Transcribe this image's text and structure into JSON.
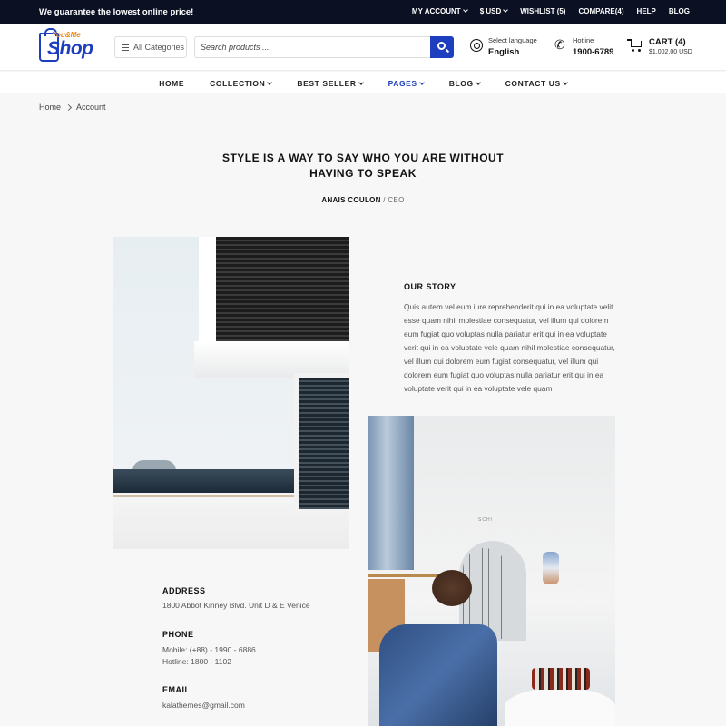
{
  "topbar": {
    "promo": "We guarantee the lowest online price!",
    "links": [
      {
        "label": "MY ACCOUNT",
        "dropdown": true
      },
      {
        "label": "$ USD",
        "dropdown": true
      },
      {
        "label": "WISHLIST (5)",
        "dropdown": false
      },
      {
        "label": "COMPARE(4)",
        "dropdown": false
      },
      {
        "label": "HELP",
        "dropdown": false
      },
      {
        "label": "BLOG",
        "dropdown": false
      }
    ]
  },
  "logo": {
    "small": "You&Me",
    "big": "Shop"
  },
  "header": {
    "categories_label": "All Categories",
    "search_placeholder": "Search products ...",
    "language_label": "Select language",
    "language_value": "English",
    "hotline_label": "Hotline",
    "hotline_value": "1900-6789",
    "cart_label": "CART (4)",
    "cart_total": "$1,002.00 USD"
  },
  "nav": {
    "items": [
      {
        "label": "HOME",
        "dropdown": false,
        "active": false
      },
      {
        "label": "COLLECTION",
        "dropdown": true,
        "active": false
      },
      {
        "label": "BEST SELLER",
        "dropdown": true,
        "active": false
      },
      {
        "label": "PAGES",
        "dropdown": true,
        "active": true
      },
      {
        "label": "BLOG",
        "dropdown": true,
        "active": false
      },
      {
        "label": "CONTACT US",
        "dropdown": true,
        "active": false
      }
    ]
  },
  "breadcrumb": {
    "home": "Home",
    "current": "Account"
  },
  "quote": {
    "text": "STYLE IS A WAY TO SAY WHO YOU ARE WITHOUT HAVING TO SPEAK",
    "author": "ANAIS COULON",
    "separator": "/",
    "role": "CEO"
  },
  "story": {
    "title": "OUR STORY",
    "text": "Quis autem vel eum iure reprehenderit qui in ea voluptate velit esse quam nihil molestiae consequatur, vel illum qui dolorem eum fugiat quo voluptas nulla pariatur erit qui in ea voluptate verit qui in ea voluptate vele quam nihil molestiae consequatur, vel illum qui dolorem eum fugiat consequatur, vel illum qui dolorem eum fugiat quo voluptas nulla pariatur erit qui in ea voluptate verit qui in ea voluptate vele quam"
  },
  "images": {
    "architecture_sign": "",
    "boutique_sign": "SCHI"
  },
  "contact": {
    "address_title": "ADDRESS",
    "address": "1800 Abbot Kinney Blvd. Unit D & E Venice",
    "phone_title": "PHONE",
    "phone_mobile": "Mobile: (+88) - 1990 - 6886",
    "phone_hotline": "Hotline: 1800 - 1102",
    "email_title": "EMAIL",
    "email": "kalathemes@gmail.com"
  },
  "colors": {
    "topbar_bg": "#0b1023",
    "accent": "#1d3fbf",
    "logo_orange": "#f08a1c",
    "page_bg": "#f7f7f7"
  }
}
